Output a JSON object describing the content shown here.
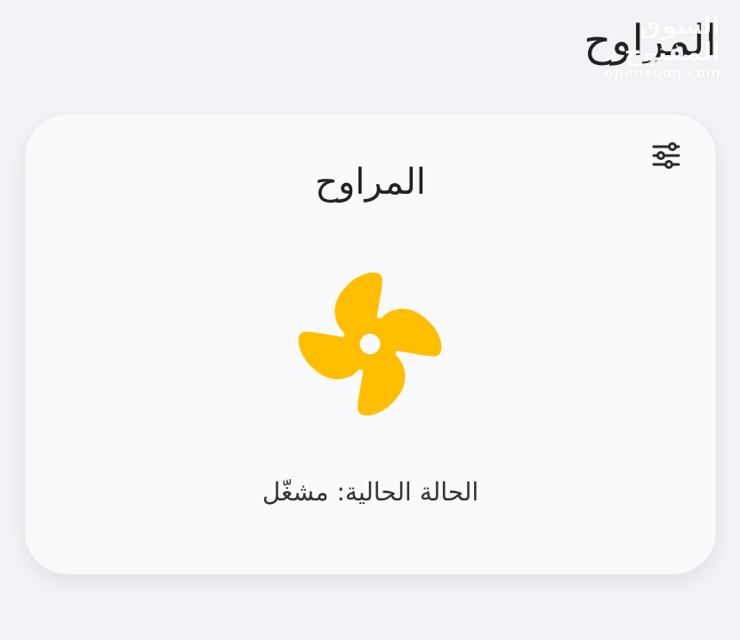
{
  "header": {
    "title": "المراوح"
  },
  "watermark": {
    "arabic": "السوق المفتوح",
    "latin": "opensooq.com"
  },
  "card": {
    "title": "المراوح",
    "status_label": "الحالة الحالية:",
    "status_value": "مشغّل",
    "settings_icon": "sliders-icon",
    "fan_icon": "fan-icon"
  },
  "colors": {
    "background": "#f2f3f6",
    "card_background": "#fafafc",
    "fan_accent": "#ffbf00",
    "text": "#2b2b2b"
  }
}
